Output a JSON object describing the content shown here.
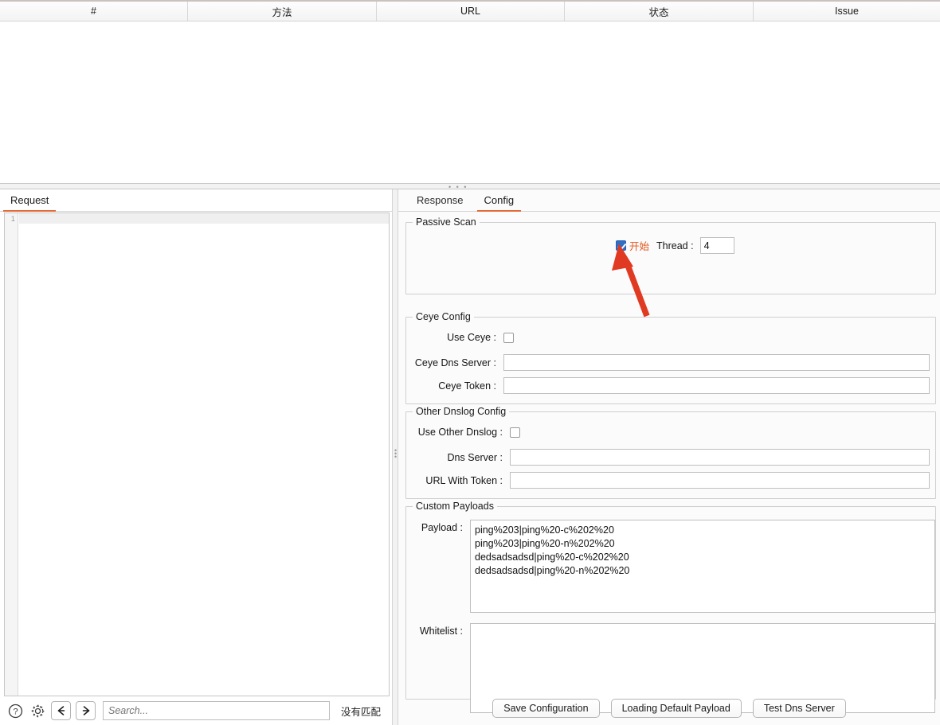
{
  "results_table": {
    "columns": [
      "#",
      "方法",
      "URL",
      "状态",
      "Issue"
    ],
    "rows": []
  },
  "left_panel": {
    "tabs": [
      {
        "label": "Request",
        "active": true
      }
    ],
    "editor": {
      "line_number": "1",
      "content": ""
    },
    "bottom_bar": {
      "help_icon": "question-circle-icon",
      "settings_icon": "gear-icon",
      "back_icon": "arrow-left-icon",
      "forward_icon": "arrow-right-icon",
      "search_placeholder": "Search...",
      "search_value": "",
      "match_status": "没有匹配"
    }
  },
  "right_panel": {
    "tabs": [
      {
        "label": "Response",
        "active": false
      },
      {
        "label": "Config",
        "active": true
      }
    ],
    "passive_scan": {
      "legend": "Passive Scan",
      "enabled_checkbox_checked": true,
      "enabled_label": "开始",
      "thread_label": "Thread :",
      "thread_value": "4"
    },
    "ceye_config": {
      "legend": "Ceye Config",
      "use_ceye_label": "Use Ceye :",
      "use_ceye_checked": false,
      "dns_server_label": "Ceye Dns Server :",
      "dns_server_value": "",
      "token_label": "Ceye Token :",
      "token_value": ""
    },
    "other_dnslog_config": {
      "legend": "Other Dnslog Config",
      "use_other_label": "Use Other Dnslog :",
      "use_other_checked": false,
      "dns_server_label": "Dns Server :",
      "dns_server_value": "",
      "url_with_token_label": "URL With Token :",
      "url_with_token_value": ""
    },
    "custom_payloads": {
      "legend": "Custom Payloads",
      "payload_label": "Payload :",
      "payload_value": "ping%203|ping%20-c%202%20\nping%203|ping%20-n%202%20\ndedsadsadsd|ping%20-c%202%20\ndedsadsadsd|ping%20-n%202%20",
      "whitelist_label": "Whitelist :",
      "whitelist_value": ""
    },
    "buttons": [
      {
        "label": "Save Configuration"
      },
      {
        "label": "Loading Default Payload"
      },
      {
        "label": "Test Dns Server"
      }
    ]
  },
  "annotation": {
    "arrow_color": "#e03a22"
  },
  "colors": {
    "accent_tab_underline": "#e26a3a",
    "checkbox_blue": "#2f6fc4",
    "start_label_orange": "#e2581f",
    "annotation_red": "#e03a22"
  }
}
